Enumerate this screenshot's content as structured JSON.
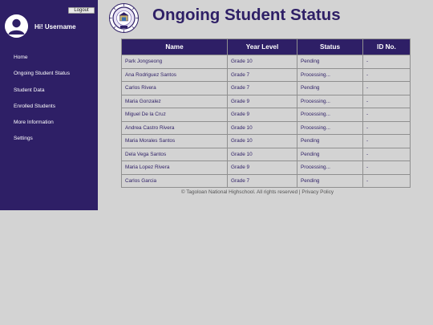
{
  "sidebar": {
    "logout_label": "Logout",
    "greeting": "Hi! Username",
    "avatar_icon": "user-avatar-icon",
    "items": [
      {
        "label": "Home"
      },
      {
        "label": "Ongoing Student Status"
      },
      {
        "label": "Student Data"
      },
      {
        "label": "Enrolled Students"
      },
      {
        "label": "More Information"
      },
      {
        "label": "Settings"
      }
    ]
  },
  "header": {
    "title": "Ongoing Student Status",
    "seal_icon": "school-seal-logo"
  },
  "table": {
    "columns": [
      "Name",
      "Year Level",
      "Status",
      "ID No."
    ],
    "rows": [
      [
        "Park Jongseong",
        "Grade 10",
        "Pending",
        "-"
      ],
      [
        "Ana Rodriguez Santos",
        "Grade 7",
        "Processing...",
        "-"
      ],
      [
        "Carlos Rivera",
        "Grade 7",
        "Pending",
        "-"
      ],
      [
        "Maria Gonzalez",
        "Grade 9",
        "Processing...",
        "-"
      ],
      [
        "Miguel De la Cruz",
        "Grade 9",
        "Processing...",
        "-"
      ],
      [
        "Andrea Castro Rivera",
        "Grade 10",
        "Processing...",
        "-"
      ],
      [
        "Maria Morales Santos",
        "Grade 10",
        "Pending",
        "-"
      ],
      [
        "Dela Vega Santos",
        "Grade 10",
        "Pending",
        "-"
      ],
      [
        "Maria Lopez Rivera",
        "Grade 9",
        "Processing...",
        "-"
      ],
      [
        "Carlos Garcia",
        "Grade 7",
        "Pending",
        "-"
      ]
    ]
  },
  "footer": {
    "copyright": "© Tagoloan National Highschool. All rights reserved",
    "separator": " | ",
    "privacy_label": "Privacy Policy"
  },
  "colors": {
    "brand": "#2e1f66",
    "background": "#d3d3d3",
    "border": "#8f8f8f"
  }
}
